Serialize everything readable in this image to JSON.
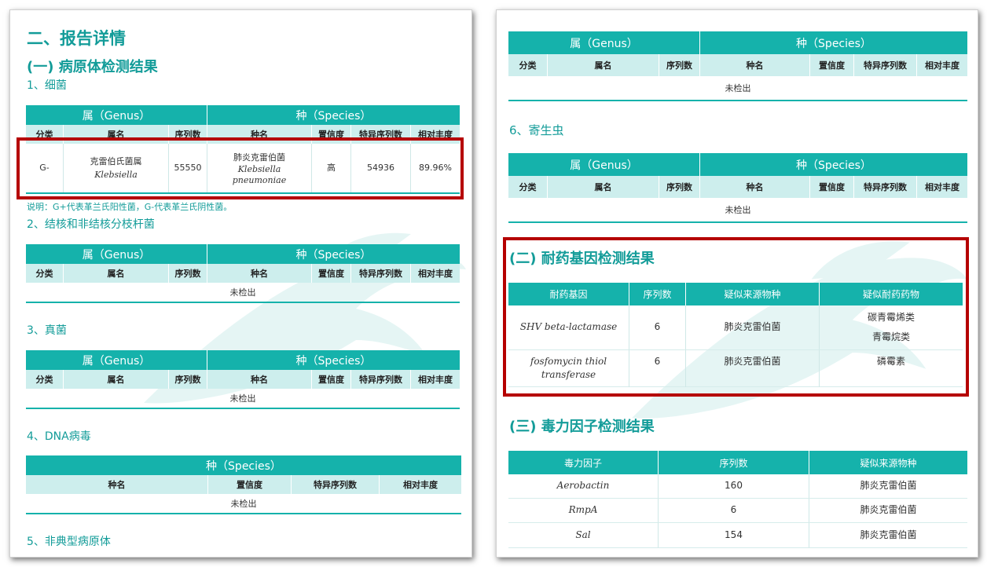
{
  "left": {
    "title": "二、报告详情",
    "section1": "(一) 病原体检测结果",
    "sub_bacteria": "1、细菌",
    "sub_tb": "2、结核和非结核分枝杆菌",
    "sub_fungi": "3、真菌",
    "sub_dna": "4、DNA病毒",
    "sub_atypical": "5、非典型病原体",
    "note": "说明：G+代表革兰氏阳性菌，G-代表革兰氏阴性菌。"
  },
  "right": {
    "sub_parasite": "6、寄生虫",
    "section2": "(二) 耐药基因检测结果",
    "section3": "(三) 毒力因子检测结果"
  },
  "table": {
    "genus_header": "属（Genus）",
    "species_header": "种（Species）",
    "col_class": "分类",
    "col_genus_name": "属名",
    "col_seq": "序列数",
    "col_species_name": "种名",
    "col_conf": "置信度",
    "col_specific": "特异序列数",
    "col_abundance": "相对丰度",
    "not_detected": "未检出"
  },
  "bacteria_row": {
    "class": "G-",
    "genus_cn": "克雷伯氏菌属",
    "genus_latin": "Klebsiella",
    "seq": "55550",
    "species_cn": "肺炎克雷伯菌",
    "species_latin": "Klebsiella pneumoniae",
    "conf": "高",
    "specific": "54936",
    "abundance": "89.96%"
  },
  "resistance": {
    "headers": [
      "耐药基因",
      "序列数",
      "疑似来源物种",
      "疑似耐药药物"
    ],
    "rows": [
      {
        "gene": "SHV beta-lactamase",
        "seq": "6",
        "source": "肺炎克雷伯菌",
        "drug1": "碳青霉烯类",
        "drug2": "青霉烷类"
      },
      {
        "gene": "fosfomycin thiol transferase",
        "seq": "6",
        "source": "肺炎克雷伯菌",
        "drug1": "磷霉素",
        "drug2": ""
      }
    ]
  },
  "virulence": {
    "headers": [
      "毒力因子",
      "序列数",
      "疑似来源物种"
    ],
    "rows": [
      {
        "factor": "Aerobactin",
        "seq": "160",
        "source": "肺炎克雷伯菌"
      },
      {
        "factor": "RmpA",
        "seq": "6",
        "source": "肺炎克雷伯菌"
      },
      {
        "factor": "Sal",
        "seq": "154",
        "source": "肺炎克雷伯菌"
      }
    ]
  },
  "colors": {
    "accent": "#15b2ab",
    "light": "#cdeeed",
    "highlight": "#b50000"
  }
}
